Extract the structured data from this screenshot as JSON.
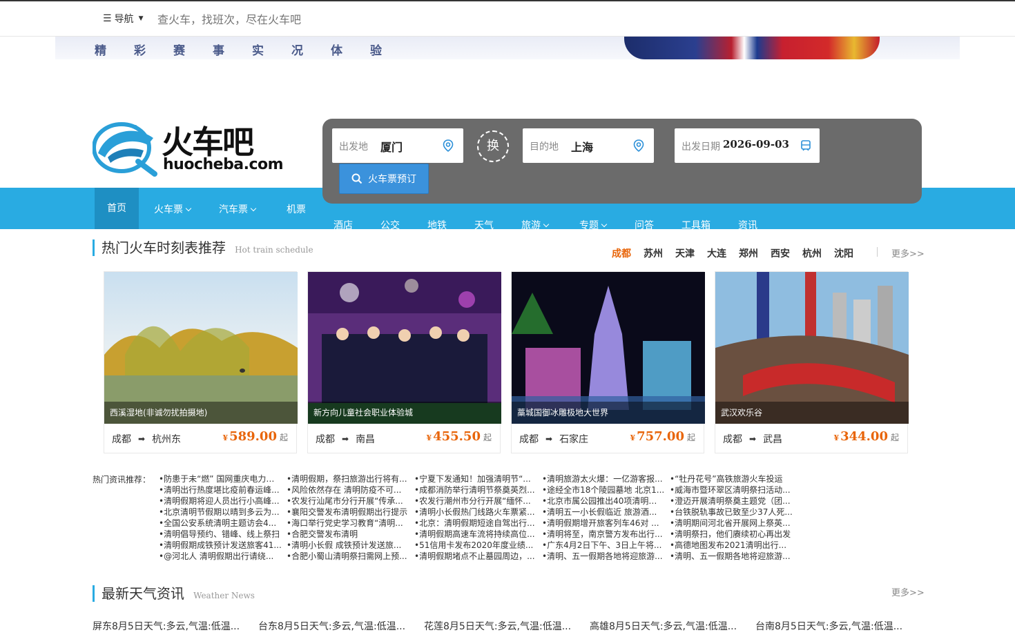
{
  "topbar": {
    "nav_label": "导航",
    "search_placeholder": "查火车，找班次，尽在火车吧"
  },
  "banner": {
    "text": [
      "精",
      "彩",
      "赛",
      "事",
      "实",
      "况",
      "体",
      "验"
    ]
  },
  "logo": {
    "name_cn": "火车吧",
    "domain": "huocheba.com"
  },
  "main_nav": {
    "row1": [
      {
        "label": "首页",
        "has_menu": false,
        "active": true
      },
      {
        "label": "火车票",
        "has_menu": true
      },
      {
        "label": "汽车票",
        "has_menu": true
      },
      {
        "label": "机票",
        "has_menu": false
      }
    ],
    "row2": [
      {
        "label": "酒店",
        "has_menu": false
      },
      {
        "label": "公交",
        "has_menu": false
      },
      {
        "label": "地铁",
        "has_menu": false
      },
      {
        "label": "天气",
        "has_menu": false
      },
      {
        "label": "旅游",
        "has_menu": true
      },
      {
        "label": "专题",
        "has_menu": true
      },
      {
        "label": "问答",
        "has_menu": false
      },
      {
        "label": "工具箱",
        "has_menu": false
      },
      {
        "label": "资讯",
        "has_menu": false
      }
    ]
  },
  "search": {
    "from_label": "出发地",
    "from_value": "厦门",
    "swap_label": "换",
    "to_label": "目的地",
    "to_value": "上海",
    "date_label": "出发日期",
    "date_value": "2026-09-03",
    "book_label": "火车票预订"
  },
  "hot_trains": {
    "title": "热门火车时刻表推荐",
    "subtitle": "Hot train schedule",
    "cities": [
      "成都",
      "苏州",
      "天津",
      "大连",
      "郑州",
      "西安",
      "杭州",
      "沈阳"
    ],
    "active_city": "成都",
    "more": "更多>>",
    "cards": [
      {
        "caption": "西溪湿地(非诚勿扰拍摄地)",
        "from": "成都",
        "to": "杭州东",
        "price": "589.00",
        "currency": "¥",
        "suffix": "起"
      },
      {
        "caption": "新方向儿童社会职业体验城",
        "from": "成都",
        "to": "南昌",
        "price": "455.50",
        "currency": "¥",
        "suffix": "起"
      },
      {
        "caption": "藁城国御冰雕极地大世界",
        "from": "成都",
        "to": "石家庄",
        "price": "757.00",
        "currency": "¥",
        "suffix": "起"
      },
      {
        "caption": "武汉欢乐谷",
        "from": "成都",
        "to": "武昌",
        "price": "344.00",
        "currency": "¥",
        "suffix": "起"
      }
    ]
  },
  "hot_news": {
    "label": "热门资讯推荐：",
    "columns": [
      [
        "•防患于未“燃” 国网重庆电力确...",
        "•清明出行热度堪比疫前春运峰...",
        "•清明假期将迎人员出行小高峰...",
        "•北京清明节假期以晴到多云为...",
        "•全国公安系统清明主题访会4...",
        "•清明倡导预约、错峰、线上祭扫",
        "•清明假期成铁预计发送旅客41...",
        "•@河北人 清明假期出行请绕..."
      ],
      [
        "•清明假期，祭扫旅游出行将有...",
        "•风险依然存在 清明防疫不可...",
        "•农发行汕尾市分行开展“传承...",
        "•襄阳交警发布清明假期出行提示",
        "•海口举行党史学习教育“清明...",
        "•合肥交警发布清明",
        "•清明小长假 成铁预计发送旅...",
        "•合肥小蜀山清明祭扫需网上预..."
      ],
      [
        "•宁夏下发通知！加强清明节“...",
        "•成都消防举行清明节祭奠英烈...",
        "•农发行潮州市分行开展“缅怀...",
        "•清明小长假热门线路火车票紧...",
        "•北京：清明假期短途自驾出行...",
        "•清明假期高速车流将持续高位...",
        "•51信用卡发布2020年度业绩...",
        "•清明假期堵点不止墓园周边，..."
      ],
      [
        "•清明旅游太火爆：一亿游客报...",
        "•途经全市18个陵园墓地 北京1...",
        "•北京市属公园推出40项清明活动",
        "•清明五一小长假临近 旅游酒...",
        "•清明假期增开旅客列车46对 ...",
        "•清明将至，南京警方发布出行...",
        "•广东4月2日下午、3日上午将...",
        "•清明、五一假期各地将迎旅游..."
      ],
      [
        "•“牡丹花号”高铁旅游火车投运",
        "•威海市暨环翠区清明祭扫活动...",
        "•澄迈开展清明祭奠主题党（团...",
        "•台铁脱轨事故已致至少37人死...",
        "•清明期间河北省开展网上祭英...",
        "•清明祭扫，他们赓续初心再出发",
        "•高德地图发布2021清明出行...",
        "•清明、五一假期各地将迎旅游..."
      ]
    ]
  },
  "weather": {
    "title": "最新天气资讯",
    "subtitle": "Weather News",
    "more": "更多>>",
    "items": [
      "屏东8月5日天气:多云,气温:低温...",
      "台东8月5日天气:多云,气温:低温...",
      "花莲8月5日天气:多云,气温:低温...",
      "高雄8月5日天气:多云,气温:低温...",
      "台南8月5日天气:多云,气温:低温..."
    ]
  },
  "colors": {
    "nav_blue": "#29abe2",
    "price_orange": "#e8650a",
    "search_panel": "#6b6b6b"
  }
}
